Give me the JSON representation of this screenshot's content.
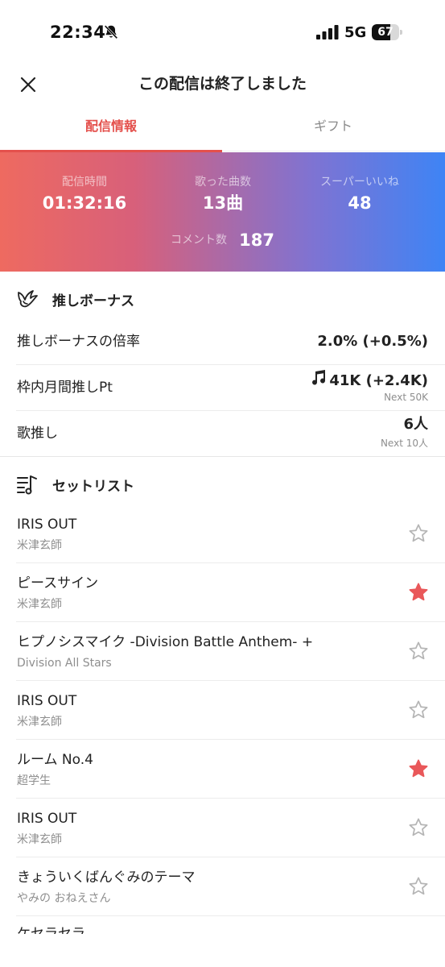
{
  "status_bar": {
    "time": "22:34",
    "network": "5G",
    "battery_percent": "67",
    "battery_level": 0.67
  },
  "header": {
    "title": "この配信は終了しました",
    "close_icon": "close-icon"
  },
  "tabs": [
    {
      "label": "配信情報",
      "active": true
    },
    {
      "label": "ギフト",
      "active": false
    }
  ],
  "stats": {
    "duration": {
      "label": "配信時間",
      "value": "01:32:16"
    },
    "songs": {
      "label": "歌った曲数",
      "value": "13曲"
    },
    "super_likes": {
      "label": "スーパーいいね",
      "value": "48"
    },
    "comments": {
      "label": "コメント数",
      "value": "187"
    }
  },
  "oshi_bonus": {
    "title": "推しボーナス",
    "icon": "wing-icon",
    "rows": [
      {
        "label": "推しボーナスの倍率",
        "value": "2.0% (+0.5%)",
        "sub": ""
      },
      {
        "label": "枠内月間推しPt",
        "value": "41K (+2.4K)",
        "sub": "Next 50K",
        "icon": "music-note-icon"
      },
      {
        "label": "歌推し",
        "value": "6人",
        "sub": "Next 10人"
      }
    ]
  },
  "setlist": {
    "title": "セットリスト",
    "icon": "music-list-icon",
    "songs": [
      {
        "title": "IRIS OUT",
        "artist": "米津玄師",
        "starred": false
      },
      {
        "title": "ピースサイン",
        "artist": "米津玄師",
        "starred": true
      },
      {
        "title": "ヒプノシスマイク -Division Battle Anthem- +",
        "artist": "Division All Stars",
        "starred": false
      },
      {
        "title": "IRIS OUT",
        "artist": "米津玄師",
        "starred": false
      },
      {
        "title": "ルーム No.4",
        "artist": "超学生",
        "starred": true
      },
      {
        "title": "IRIS OUT",
        "artist": "米津玄師",
        "starred": false
      },
      {
        "title": "きょういくばんぐみのテーマ",
        "artist": "やみの おねえさん",
        "starred": false
      }
    ],
    "partial_next_title": "ケセラセラ"
  },
  "colors": {
    "accent": "#e4504c",
    "star_filled": "#e9585a",
    "star_empty": "#b5b5b5",
    "gradient_start": "#ee6a60",
    "gradient_end": "#3e84f5"
  }
}
